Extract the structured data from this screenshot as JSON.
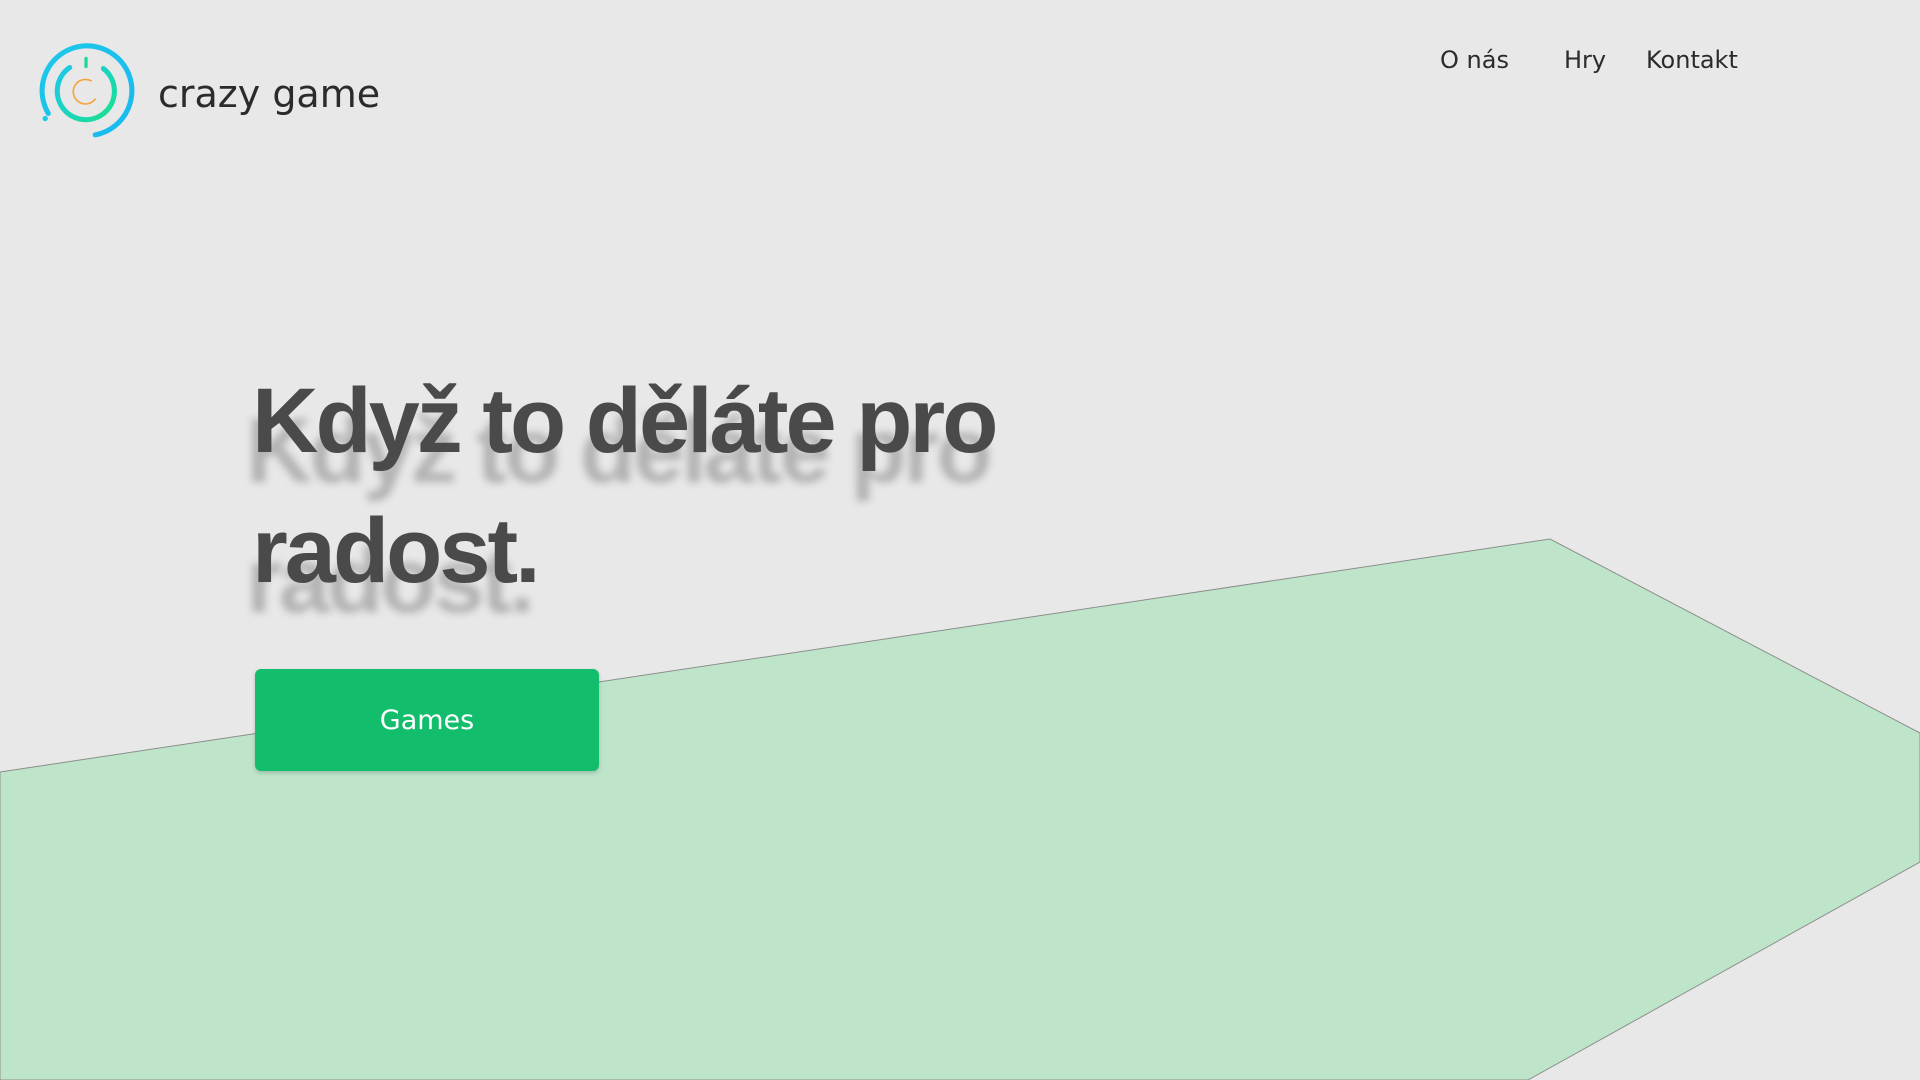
{
  "brand": {
    "name": "crazy game",
    "logo_icon": "ring-logo-icon"
  },
  "nav": {
    "items": [
      {
        "label": "O nás"
      },
      {
        "label": "Hry"
      },
      {
        "label": "Kontakt"
      }
    ]
  },
  "hero": {
    "title": "Když to děláte pro radost.",
    "button_label": "Games"
  },
  "colors": {
    "background": "#e9e8e9",
    "accent": "#12bd6b",
    "shape_fill": "#bee5ca",
    "logo_cyan": "#1ec8e8",
    "logo_green": "#19d89a",
    "logo_orange": "#f3a63b",
    "title_text": "#4a4a4a"
  }
}
